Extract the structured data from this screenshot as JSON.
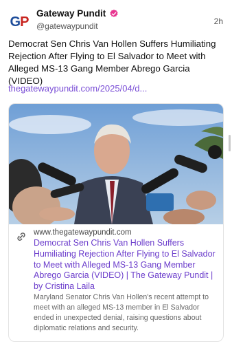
{
  "post": {
    "account_name": "Gateway Pundit",
    "handle": "@gatewaypundit",
    "time": "2h",
    "avatar_text": {
      "g": "G",
      "p": "P"
    },
    "text": "Democrat Sen Chris Van Hollen Suffers Humiliating Rejection After Flying to El Salvador to Meet with Alleged MS-13 Gang Member Abrego Garcia (VIDEO)",
    "link_text": "thegatewaypundit.com/2025/04/d..."
  },
  "card": {
    "domain": "www.thegatewaypundit.com",
    "title": "Democrat Sen Chris Van Hollen Suffers Humiliating Rejection After Flying to El Salvador to Meet with Alleged MS-13 Gang Member Abrego Garcia (VIDEO) | The Gateway Pundit | by Cristina Laila",
    "description": "Maryland Senator Chris Van Hollen's recent attempt to meet with an alleged MS-13 member in El Salvador ended in unexpected denial, raising questions about diplomatic relations and security."
  },
  "colors": {
    "link": "#7a4ed6",
    "card_title": "#6d3fcc",
    "verified_badge": "#e8348f",
    "logo_blue": "#1d4c9a",
    "logo_red": "#c8241f"
  },
  "icons": [
    "verified-badge-icon",
    "link-icon"
  ]
}
